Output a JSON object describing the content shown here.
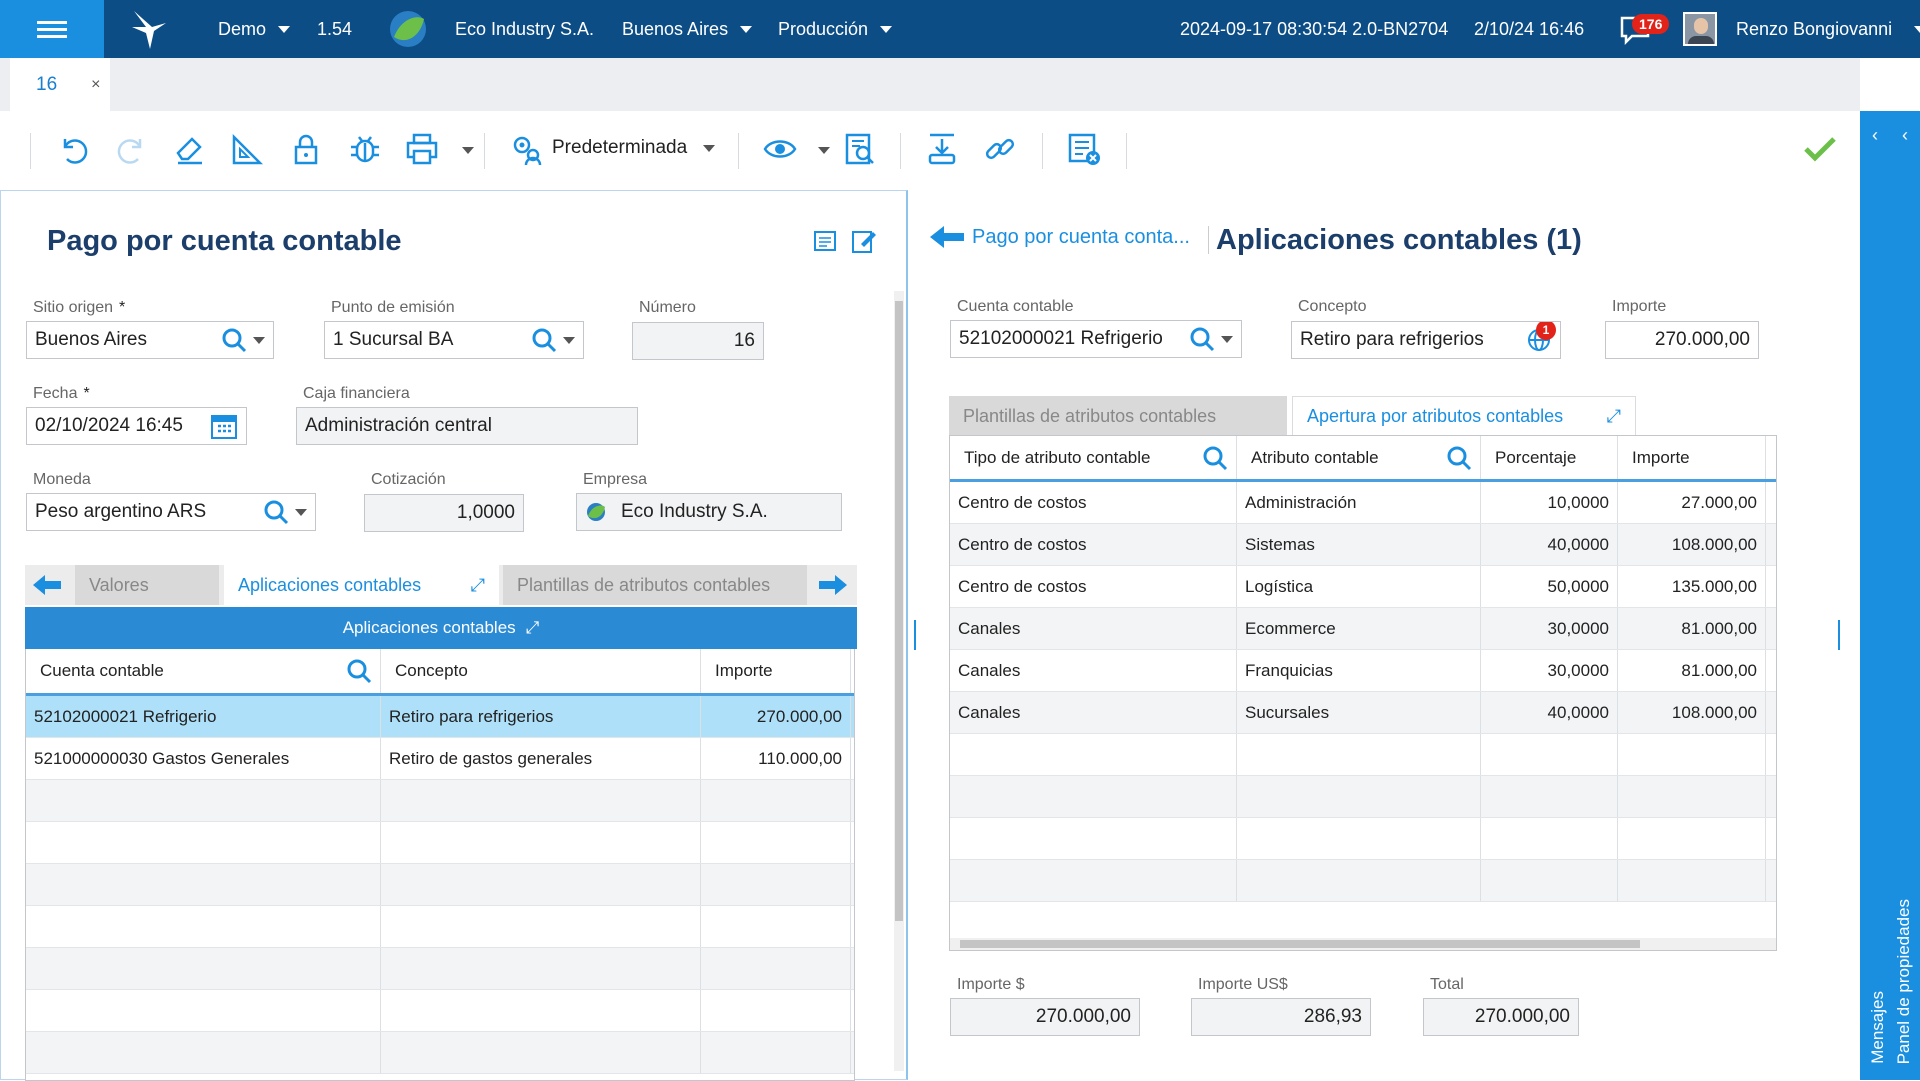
{
  "topbar": {
    "env": "Demo",
    "version": "1.54",
    "company": "Eco Industry S.A.",
    "city": "Buenos Aires",
    "mode": "Producción",
    "build": "2024-09-17 08:30:54 2.0-BN2704",
    "datetime": "2/10/24 16:46",
    "notifications": "176",
    "user": "Renzo Bongiovanni"
  },
  "tabs": {
    "doc_tab": "16",
    "close": "×"
  },
  "toolbar": {
    "view_label": "Predeterminada"
  },
  "left": {
    "title": "Pago por cuenta contable",
    "sitio_label": "Sitio origen",
    "sitio_value": "Buenos Aires",
    "punto_label": "Punto de emisión",
    "punto_value": "1 Sucursal BA",
    "numero_label": "Número",
    "numero_value": "16",
    "fecha_label": "Fecha",
    "fecha_value": "02/10/2024 16:45",
    "caja_label": "Caja financiera",
    "caja_value": "Administración central",
    "moneda_label": "Moneda",
    "moneda_value": "Peso argentino ARS",
    "cotizacion_label": "Cotización",
    "cotizacion_value": "1,0000",
    "empresa_label": "Empresa",
    "empresa_value": "Eco Industry S.A.",
    "tabs": [
      "Valores",
      "Aplicaciones contables",
      "Plantillas de atributos contables"
    ],
    "section_header": "Aplicaciones contables",
    "grid": {
      "columns": [
        "Cuenta contable",
        "Concepto",
        "Importe"
      ],
      "rows": [
        [
          "52102000021 Refrigerio",
          "Retiro para refrigerios",
          "270.000,00"
        ],
        [
          "521000000030 Gastos Generales",
          "Retiro de gastos generales",
          "110.000,00"
        ]
      ]
    }
  },
  "right": {
    "back_label": "Pago por cuenta conta...",
    "title": "Aplicaciones contables (1)",
    "cuenta_label": "Cuenta contable",
    "cuenta_value": "52102000021 Refrigerio",
    "concepto_label": "Concepto",
    "concepto_value": "Retiro para refrigerios",
    "concepto_badge": "1",
    "importe_label": "Importe",
    "importe_value": "270.000,00",
    "tabs": [
      "Plantillas de atributos contables",
      "Apertura por atributos contables"
    ],
    "grid": {
      "columns": [
        "Tipo de atributo contable",
        "Atributo contable",
        "Porcentaje",
        "Importe"
      ],
      "rows": [
        [
          "Centro de costos",
          "Administración",
          "10,0000",
          "27.000,00"
        ],
        [
          "Centro de costos",
          "Sistemas",
          "40,0000",
          "108.000,00"
        ],
        [
          "Centro de costos",
          "Logística",
          "50,0000",
          "135.000,00"
        ],
        [
          "Canales",
          "Ecommerce",
          "30,0000",
          "81.000,00"
        ],
        [
          "Canales",
          "Franquicias",
          "30,0000",
          "81.000,00"
        ],
        [
          "Canales",
          "Sucursales",
          "40,0000",
          "108.000,00"
        ]
      ]
    },
    "importe_pesos_label": "Importe $",
    "importe_pesos_value": "270.000,00",
    "importe_usd_label": "Importe US$",
    "importe_usd_value": "286,93",
    "total_label": "Total",
    "total_value": "270.000,00"
  },
  "sidebar": {
    "mensajes": "Mensajes",
    "panel": "Panel de propiedades"
  },
  "colors": {
    "topbar": "#0c4d85",
    "accent": "#1a8fe0",
    "title": "#1b3e6b",
    "selected_row": "#aee0fa",
    "ok_check": "#6cc04a"
  }
}
